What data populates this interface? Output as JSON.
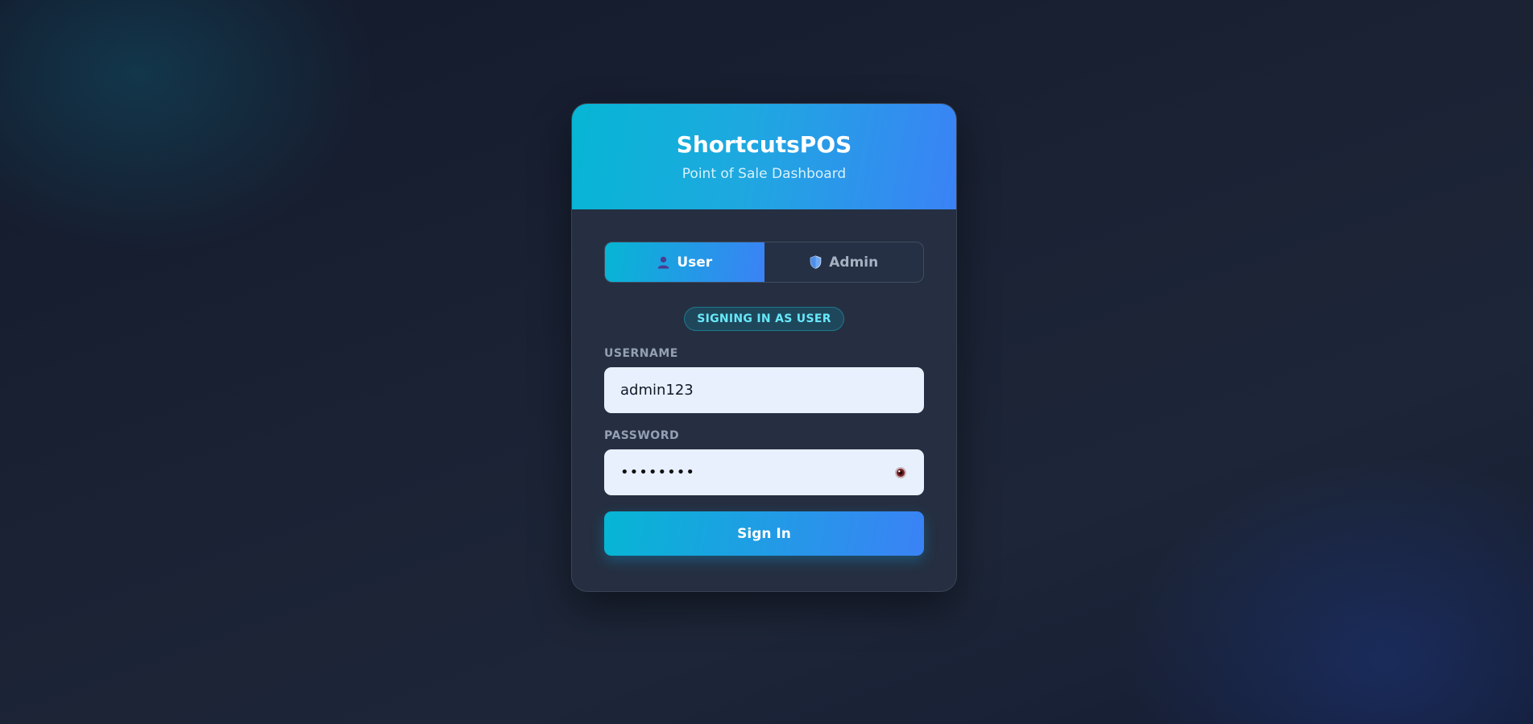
{
  "app": {
    "title": "ShortcutsPOS",
    "subtitle": "Point of Sale Dashboard"
  },
  "role_toggle": {
    "tabs": [
      {
        "label": "User",
        "icon": "user-icon",
        "active": true
      },
      {
        "label": "Admin",
        "icon": "shield-icon",
        "active": false
      }
    ]
  },
  "status_badge": "SIGNING IN AS USER",
  "form": {
    "username_label": "USERNAME",
    "username_value": "admin123",
    "password_label": "PASSWORD",
    "password_masked": "••••••••",
    "password_toggle_icon": "eye-icon",
    "submit_label": "Sign In"
  },
  "colors": {
    "accent_start": "#06b6d4",
    "accent_end": "#3b82f6",
    "card_bg": "#252f41",
    "input_bg": "#e8f0fe",
    "badge_text": "#67e8f9"
  }
}
